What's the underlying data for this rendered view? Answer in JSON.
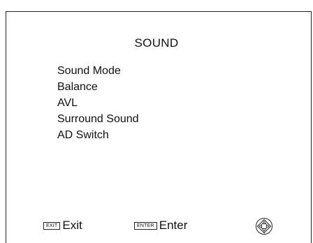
{
  "menu": {
    "title": "SOUND",
    "items": [
      {
        "label": "Sound Mode"
      },
      {
        "label": "Balance"
      },
      {
        "label": "AVL"
      },
      {
        "label": "Surround Sound"
      },
      {
        "label": "AD Switch"
      }
    ]
  },
  "footer": {
    "exit_key": "EXIT",
    "exit_label": "Exit",
    "enter_key": "ENTER",
    "enter_label": "Enter",
    "nav_icon": "four-way-navigation-icon"
  }
}
